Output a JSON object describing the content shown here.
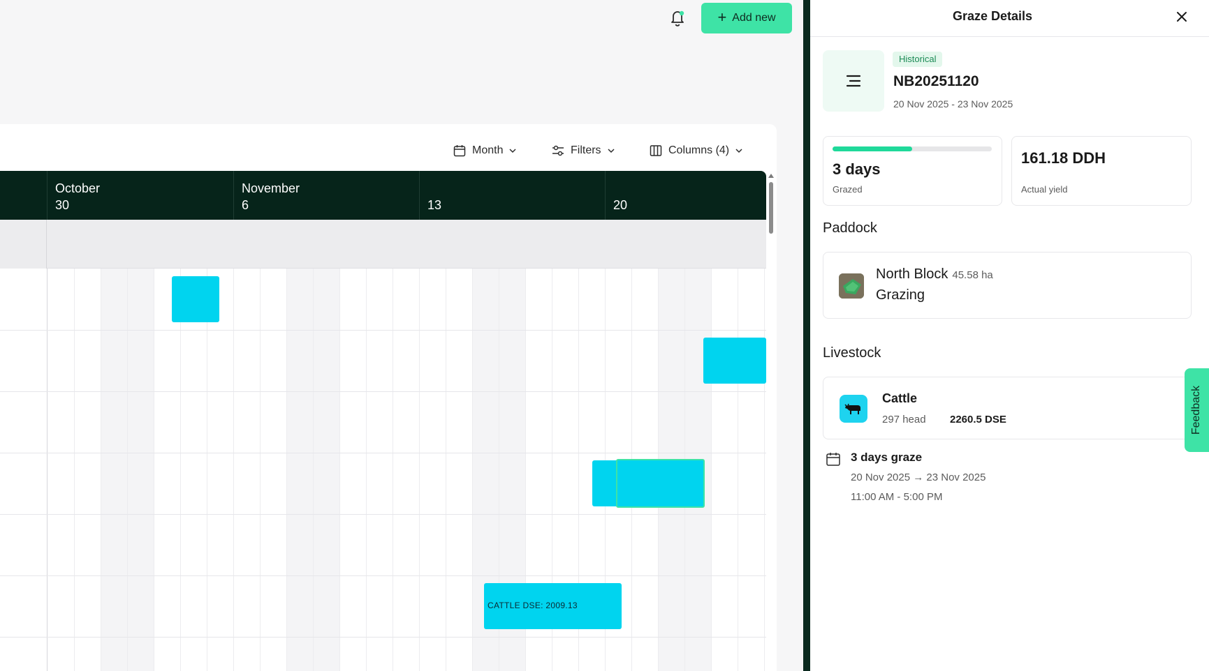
{
  "header": {
    "add_new_label": "Add new",
    "colors": {
      "accent": "#3ee3a6",
      "dark": "#06241a",
      "bar": "#00d4ef"
    }
  },
  "toolbar": {
    "view_label": "Month",
    "filters_label": "Filters",
    "columns_label": "Columns (4)"
  },
  "timeline": {
    "columns": [
      {
        "month": "October",
        "day": "30"
      },
      {
        "month": "November",
        "day": "6"
      },
      {
        "month": "",
        "day": "13"
      },
      {
        "month": "",
        "day": "20"
      }
    ],
    "bar_label": "CATTLE DSE: 2009.13"
  },
  "panel": {
    "title": "Graze Details",
    "status_badge": "Historical",
    "graze_id": "NB20251120",
    "date_range": "20 Nov 2025 - 23 Nov 2025",
    "stats": {
      "grazed_value": "3 days",
      "grazed_label": "Grazed",
      "grazed_progress": 0.5,
      "yield_value": "161.18 DDH",
      "yield_label": "Actual yield"
    },
    "paddock": {
      "section_title": "Paddock",
      "name": "North Block",
      "area": "45.58 ha",
      "status": "Grazing"
    },
    "livestock": {
      "section_title": "Livestock",
      "name": "Cattle",
      "head": "297 head",
      "dse": "2260.5 DSE"
    },
    "schedule": {
      "days": "3 days graze",
      "dates": "20 Nov 2025 → 23 Nov 2025",
      "times": "11:00 AM - 5:00 PM"
    }
  },
  "feedback_label": "Feedback"
}
